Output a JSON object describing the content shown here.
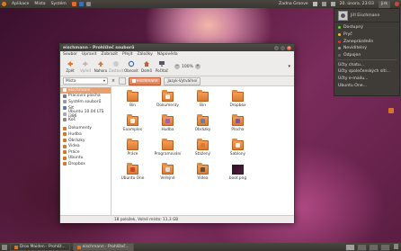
{
  "top_panel": {
    "menus": [
      "Aplikace",
      "Místa",
      "Systém"
    ],
    "clock": "20. února, 23:03",
    "user": "jirk",
    "tray_labels": [
      "Zadna Groove"
    ]
  },
  "user_menu": {
    "username": "Jiří Eischmann",
    "statuses": [
      "Dostupný",
      "Pryč",
      "Zaneprázdněn",
      "Neviditelný",
      "Odpojen"
    ],
    "items": [
      "Účty chatu...",
      "Účty společenských sítí...",
      "Účty e-mailu...",
      "Ubuntu One..."
    ]
  },
  "window": {
    "title": "eischmann - Prohlížeč souborů",
    "menu": [
      "Soubor",
      "Upravit",
      "Zobrazit",
      "Přejít",
      "Záložky",
      "Nápověda"
    ],
    "toolbar": [
      {
        "label": "Zpět",
        "icon": "back-icon",
        "disabled": false
      },
      {
        "label": "Vpřed",
        "icon": "forward-icon",
        "disabled": true
      },
      {
        "label": "Nahoru",
        "icon": "up-icon",
        "disabled": false
      },
      {
        "label": "Zastavit",
        "icon": "stop-icon",
        "disabled": true
      },
      {
        "label": "Obnovit",
        "icon": "reload-icon",
        "disabled": false
      },
      {
        "label": "Domů",
        "icon": "home-icon",
        "disabled": false
      },
      {
        "label": "Počítač",
        "icon": "computer-icon",
        "disabled": false
      }
    ],
    "zoom": "100%",
    "places_selector": "Místa",
    "breadcrumbs": [
      "eischmann",
      "Jazyk-Vytváření"
    ],
    "sidebar": [
      {
        "label": "eischmann",
        "color": "#b46b42",
        "selected": true
      },
      {
        "label": "Pracovní plocha",
        "color": "#7a7a7a",
        "selected": false
      },
      {
        "label": "Systém souborů",
        "color": "#999999",
        "selected": false
      },
      {
        "label": "Síť",
        "color": "#5a7ab0",
        "selected": false
      },
      {
        "label": "Ubuntu 10.04 LTS i386",
        "color": "#aaaaaa",
        "selected": false
      },
      {
        "label": "Koš",
        "color": "#888888",
        "selected": false
      },
      {
        "label": "",
        "color": "",
        "selected": false
      },
      {
        "label": "Dokumenty",
        "color": "#d9752a",
        "selected": false
      },
      {
        "label": "Hudba",
        "color": "#d9752a",
        "selected": false
      },
      {
        "label": "Obrázky",
        "color": "#d9752a",
        "selected": false
      },
      {
        "label": "Videa",
        "color": "#d9752a",
        "selected": false
      },
      {
        "label": "Práce",
        "color": "#d9752a",
        "selected": false
      },
      {
        "label": "Ubuntu",
        "color": "#d9752a",
        "selected": false
      },
      {
        "label": "Dropbox",
        "color": "#d9752a",
        "selected": false
      }
    ],
    "files": [
      {
        "name": "Bin",
        "kind": "folder",
        "emblem": ""
      },
      {
        "name": "Dokumenty",
        "kind": "folder",
        "emblem": "#ffffff"
      },
      {
        "name": "Bin",
        "kind": "folder",
        "emblem": ""
      },
      {
        "name": "Dropbox",
        "kind": "folder",
        "emblem": ""
      },
      {
        "name": "",
        "kind": "empty",
        "emblem": ""
      },
      {
        "name": "Examples",
        "kind": "folder",
        "emblem": "#ffffff"
      },
      {
        "name": "Hudba",
        "kind": "folder",
        "emblem": "#9b59b6"
      },
      {
        "name": "Obrázky",
        "kind": "folder",
        "emblem": "#5a7ab0"
      },
      {
        "name": "Plocha",
        "kind": "folder",
        "emblem": "#7a4a8a"
      },
      {
        "name": "",
        "kind": "empty",
        "emblem": ""
      },
      {
        "name": "Práce",
        "kind": "folder",
        "emblem": ""
      },
      {
        "name": "Programování",
        "kind": "folder",
        "emblem": ""
      },
      {
        "name": "Stažený",
        "kind": "folder",
        "emblem": "#d9752a"
      },
      {
        "name": "Šablony",
        "kind": "folder",
        "emblem": "#ffffff"
      },
      {
        "name": "",
        "kind": "empty",
        "emblem": ""
      },
      {
        "name": "Ubuntu One",
        "kind": "folder",
        "emblem": "#c0392b"
      },
      {
        "name": "Veřejné",
        "kind": "folder",
        "emblem": "#e8e8e8"
      },
      {
        "name": "Videa",
        "kind": "folder",
        "emblem": "#444444"
      },
      {
        "name": "boot.png",
        "kind": "image",
        "emblem": ""
      },
      {
        "name": "",
        "kind": "empty",
        "emblem": ""
      }
    ],
    "status": "18 položek, Volné místo: 11,3 GB"
  },
  "bottom_panel": {
    "tasks": [
      {
        "label": "Drox Maiden - Prohlíž...",
        "active": false
      },
      {
        "label": "eischmann - Prohlížeč...",
        "active": true
      }
    ]
  }
}
